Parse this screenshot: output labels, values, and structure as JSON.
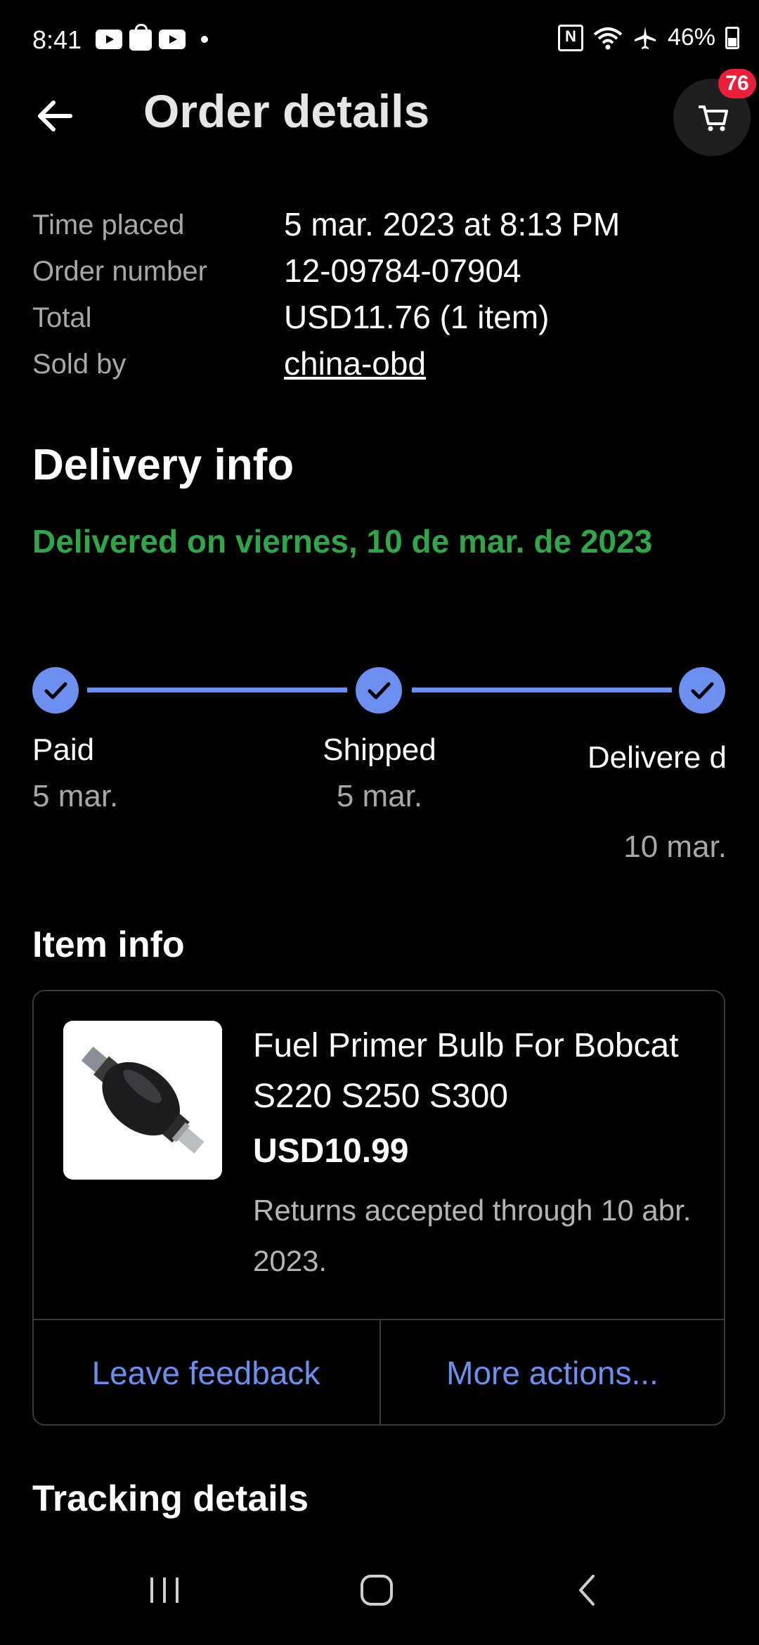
{
  "status_bar": {
    "time": "8:41",
    "battery": "46%",
    "left_icons": [
      "youtube-icon",
      "bag-icon",
      "youtube-icon",
      "dot-icon"
    ],
    "right_icons": [
      "nfc-icon",
      "wifi-icon",
      "airplane-icon",
      "battery-icon"
    ]
  },
  "header": {
    "title": "Order details",
    "cart_count": "76"
  },
  "summary": {
    "rows": [
      {
        "label": "Time placed",
        "value": "5 mar. 2023 at 8:13 PM"
      },
      {
        "label": "Order number",
        "value": "12-09784-07904"
      },
      {
        "label": "Total",
        "value": "USD11.76 (1 item)"
      },
      {
        "label": "Sold by",
        "value": "china-obd"
      }
    ]
  },
  "delivery": {
    "heading": "Delivery info",
    "status": "Delivered on viernes, 10 de mar. de 2023",
    "status_color": "#2fa64a",
    "accent_color": "#6d8ff0",
    "steps": [
      {
        "label": "Paid",
        "date": "5 mar."
      },
      {
        "label": "Shipped",
        "date": "5 mar."
      },
      {
        "label": "Delivere d",
        "date": "10 mar."
      }
    ]
  },
  "item": {
    "heading": "Item info",
    "title": "Fuel Primer Bulb For Bobcat S220 S250 S300",
    "price": "USD10.99",
    "returns": "Returns accepted through 10 abr. 2023.",
    "leave_feedback": "Leave feedback",
    "more_actions": "More actions..."
  },
  "tracking": {
    "heading": "Tracking details"
  },
  "nav_bar": {
    "icons": [
      "recents-icon",
      "home-icon",
      "back-icon"
    ]
  }
}
